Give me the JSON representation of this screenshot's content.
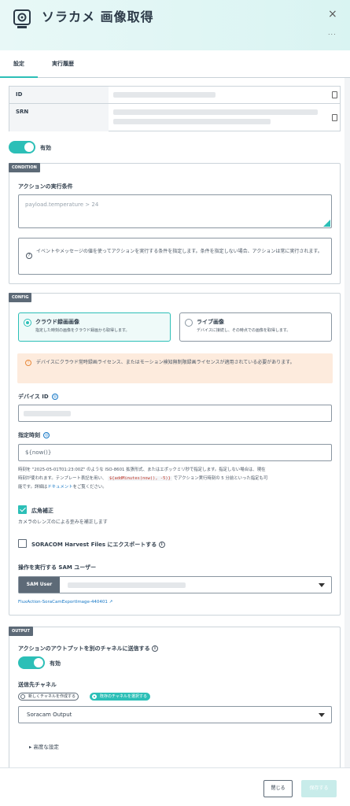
{
  "header": {
    "title": "ソラカメ 画像取得",
    "close": "×",
    "more": "..."
  },
  "tabs": [
    {
      "label": "設定"
    },
    {
      "label": "実行履歴"
    }
  ],
  "ids": {
    "id_label": "ID",
    "srn_label": "SRN"
  },
  "enabled": {
    "label": "有効"
  },
  "condition": {
    "tag": "CONDITION",
    "label": "アクションの実行条件",
    "placeholder": "payload.temperature > 24",
    "help": "イベントやメッセージの値を使ってアクションを実行する条件を指定します。条件を指定しない場合、アクションは常に実行されます。"
  },
  "config": {
    "tag": "CONFIG",
    "cloud": {
      "title": "クラウド録画画像",
      "desc": "指定した時刻の画像をクラウド録画から取得します。"
    },
    "live": {
      "title": "ライブ画像",
      "desc": "デバイスに接続し、その時点での画像を取得します。"
    },
    "warning": "デバイスにクラウド常時録画ライセンス、またはモーション検知無制限録画ライセンスが適用されている必要があります。",
    "device_id_label": "デバイス ID",
    "time_label": "指定時刻",
    "time_value": "${now()}",
    "time_help_1": "時刻を \"2025-05-01T01:23:00Z\" のような ISO-8601 拡張形式、またはエポックミリ秒で指定します。指定しない場合は、現在",
    "time_help_2": "時刻が使われます。テンプレート表記を用い、",
    "time_help_code": "${addMinutes(now(), -5)}",
    "time_help_3": "でアクション実行時刻の 5 分前といった指定も可",
    "time_help_4a": "能です。詳細は",
    "time_help_link": "ドキュメント",
    "time_help_4b": "をご覧ください。",
    "wide_label": "広角補正",
    "wide_desc": "カメラのレンズのによる歪みを補正します",
    "harvest_label": "SORACOM Harvest Files にエクスポートする",
    "sam_label": "操作を実行する SAM ユーザー",
    "sam_prefix": "SAM User",
    "sam_link": "FluxAction-SoraCamExportImage-440401"
  },
  "output": {
    "tag": "OUTPUT",
    "label": "アクションのアウトプットを別のチャネルに送信する",
    "enabled": "有効",
    "channel_label": "送信先チャネル",
    "opt_new": "新しくチャネルを作成する",
    "opt_existing": "既存のチャネルを選択する",
    "channel_value": "Soracam Output",
    "advanced": "高度な設定"
  },
  "footer": {
    "close": "閉じる",
    "save": "保存する"
  },
  "colors": {
    "accent": "#2cbfb7",
    "warning_bg": "#fdebdd",
    "tag_bg": "#5d6a77"
  }
}
